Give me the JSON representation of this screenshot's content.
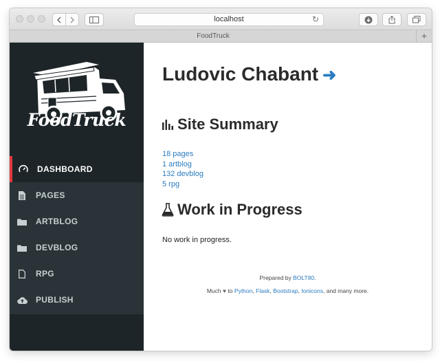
{
  "browser": {
    "url": "localhost",
    "tab_title": "FoodTruck",
    "new_tab": "+"
  },
  "sidebar": {
    "logo_text": "FoodTruck",
    "items": [
      {
        "label": "DASHBOARD",
        "icon": "speedometer-icon",
        "active": true
      },
      {
        "label": "PAGES",
        "icon": "document-icon",
        "active": false
      },
      {
        "label": "ARTBLOG",
        "icon": "folder-icon",
        "active": false
      },
      {
        "label": "DEVBLOG",
        "icon": "folder-icon",
        "active": false
      },
      {
        "label": "RPG",
        "icon": "document-outline-icon",
        "active": false
      },
      {
        "label": "PUBLISH",
        "icon": "cloud-upload-icon",
        "active": false
      }
    ],
    "accent_color": "#e0393e"
  },
  "main": {
    "title": "Ludovic Chabant",
    "title_arrow": "➜",
    "summary_heading": "Site Summary",
    "summary_links": [
      "18 pages",
      "1 artblog",
      "132 devblog",
      "5 rpg"
    ],
    "wip_heading": "Work in Progress",
    "wip_text": "No work in progress.",
    "link_color": "#2a7bbf"
  },
  "footer": {
    "prepared_by": "Prepared by",
    "author": "BOLT80",
    "period": ".",
    "much": "Much",
    "heart": "♥",
    "to": "to",
    "python": "Python",
    "flask": "Flask",
    "bootstrap": "Bootstrap",
    "ionicons": "Ionicons",
    "comma": ",",
    "and_more": ", and many more."
  }
}
